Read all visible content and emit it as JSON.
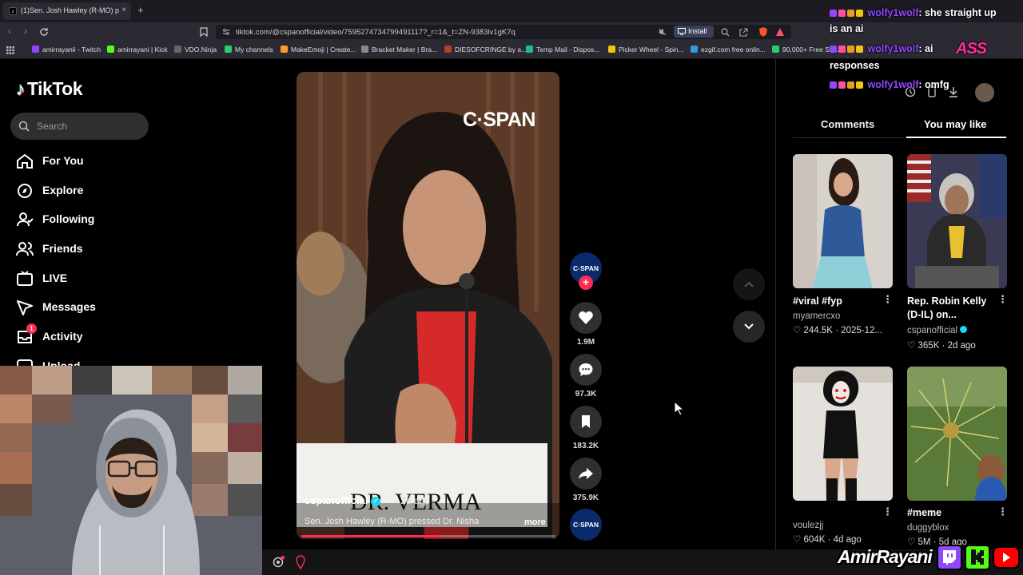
{
  "browser": {
    "tab_title": "(1)Sen. Josh Hawley (R-MO) p",
    "tab_close": "×",
    "new_tab": "+",
    "url": "tiktok.com/@cspanofficial/video/7595274734799491117?_r=1&_t=ZN-9383lv1gK7q",
    "install_label": "Install",
    "bookmarks": [
      {
        "label": "amirrayanii - Twitch",
        "color": "#9146ff"
      },
      {
        "label": "amirrayani | Kick",
        "color": "#53fc18"
      },
      {
        "label": "VDO.Ninja",
        "color": "#666"
      },
      {
        "label": "My channels",
        "color": "#2ecc71"
      },
      {
        "label": "MakeEmoji | Create...",
        "color": "#ff9a2e"
      },
      {
        "label": "Bracket Maker | Bra...",
        "color": "#888"
      },
      {
        "label": "DIESOFCRINGE by a...",
        "color": "#c0392b"
      },
      {
        "label": "Temp Mail - Dispos...",
        "color": "#1abc9c"
      },
      {
        "label": "Picker Wheel - Spin...",
        "color": "#f1c40f"
      },
      {
        "label": "ezgif.com free onlin...",
        "color": "#3498db"
      },
      {
        "label": "90,000+ Free So...",
        "color": "#2ecc71"
      }
    ]
  },
  "sidebar": {
    "logo": "TikTok",
    "search_placeholder": "Search",
    "items": [
      {
        "label": "For You"
      },
      {
        "label": "Explore"
      },
      {
        "label": "Following"
      },
      {
        "label": "Friends"
      },
      {
        "label": "LIVE"
      },
      {
        "label": "Messages"
      },
      {
        "label": "Activity",
        "badge": "1"
      },
      {
        "label": "Upload"
      }
    ]
  },
  "video": {
    "watermark": "C·SPAN",
    "podium_text": "DR. VERMA",
    "author": "cspanofficial",
    "date": "· 2d ago",
    "description": "Sen. Josh Hawley (R-MO) pressed Dr. Nisha",
    "more": "more",
    "progress": 0.55
  },
  "actions": {
    "avatar_label": "C·SPAN",
    "likes": "1.9M",
    "comments": "97.3K",
    "saves": "183.2K",
    "shares": "375.9K",
    "sound_label": "C·SPAN"
  },
  "right_panel": {
    "tab_comments": "Comments",
    "tab_you_may_like": "You may like",
    "cards": [
      {
        "title": "#viral #fyp",
        "author": "myamercxo",
        "likes": "244.5K",
        "date": "2025-12..."
      },
      {
        "title": "Rep. Robin Kelly (D-IL) on...",
        "author": "cspanofficial",
        "likes": "365K",
        "date": "2d ago"
      },
      {
        "title": "",
        "author": "voulezjj",
        "likes": "604K",
        "date": "4d ago"
      },
      {
        "title": "#meme",
        "author": "duggyblox",
        "likes": "5M",
        "date": "5d ago"
      }
    ]
  },
  "chat": [
    {
      "user": "wolfy1wolf",
      "message": ": she straight up",
      "cont": "is an ai"
    },
    {
      "user": "wolfy1wolf",
      "message": ": ai",
      "cont": "responses"
    },
    {
      "user": "wolfy1wolf",
      "message": ": omfg"
    }
  ],
  "overlay": {
    "brand_name": "AmirRayani",
    "brand_tag": "ASS"
  }
}
